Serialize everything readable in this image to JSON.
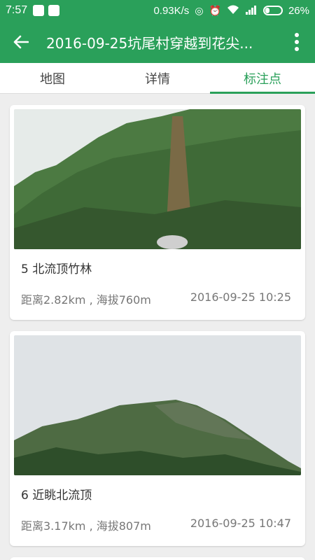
{
  "status_bar": {
    "time": "7:57",
    "network_speed": "0.93K/s",
    "battery_percent": "26%",
    "battery_level": 0.26
  },
  "app_bar": {
    "title": "2016-09-25坑尾村穿越到花尖..."
  },
  "tabs": [
    {
      "label": "地图",
      "active": false
    },
    {
      "label": "详情",
      "active": false
    },
    {
      "label": "标注点",
      "active": true
    }
  ],
  "waypoints": [
    {
      "name": "5 北流顶竹林",
      "distance_altitude": "距离2.82km , 海拔760m",
      "datetime": "2016-09-25 10:25"
    },
    {
      "name": "6 近眺北流顶",
      "distance_altitude": "距离3.17km , 海拔807m",
      "datetime": "2016-09-25 10:47"
    }
  ],
  "colors": {
    "accent": "#2aa05a"
  }
}
